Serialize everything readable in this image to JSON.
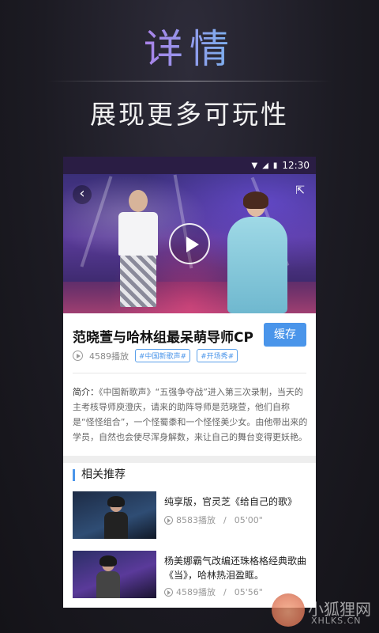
{
  "promo": {
    "title": "详情",
    "subtitle": "展现更多可玩性"
  },
  "status_bar": {
    "time": "12:30",
    "icons": [
      "wifi-icon",
      "signal-icon",
      "battery-icon"
    ]
  },
  "video": {
    "back_icon": "‹",
    "share_icon": "⇱"
  },
  "detail": {
    "title": "范晓萱与哈林组最呆萌导师CP",
    "cache_button": "缓存",
    "play_count": "4589播放",
    "tags": [
      "#中国新歌声#",
      "#开场秀#"
    ],
    "intro_label": "简介：",
    "intro_text": "《中国新歌声》“五强争夺战”进入第三次录制，当天的主考核导师庾澄庆，请来的助阵导师是范晓萱，他们自称是“怪怪组合”，一个怪蜀黍和一个怪怪美少女。由他带出来的学员，自然也会使尽浑身解数，来让自己的舞台变得更妖艳。"
  },
  "related": {
    "heading": "相关推荐",
    "items": [
      {
        "title": "纯享版，官灵芝《给自己的歌》",
        "plays": "8583播放",
        "separator": "/",
        "duration": "05'00\""
      },
      {
        "title": "杨美娜霸气改编还珠格格经典歌曲《当》，哈林热泪盈眶。",
        "plays": "4589播放",
        "separator": "/",
        "duration": "05'56\""
      }
    ]
  },
  "watermark": {
    "name": "小狐狸网",
    "url": "XHLKS.CN"
  },
  "colors": {
    "accent": "#4a95ea",
    "background": "#1c1b23"
  }
}
